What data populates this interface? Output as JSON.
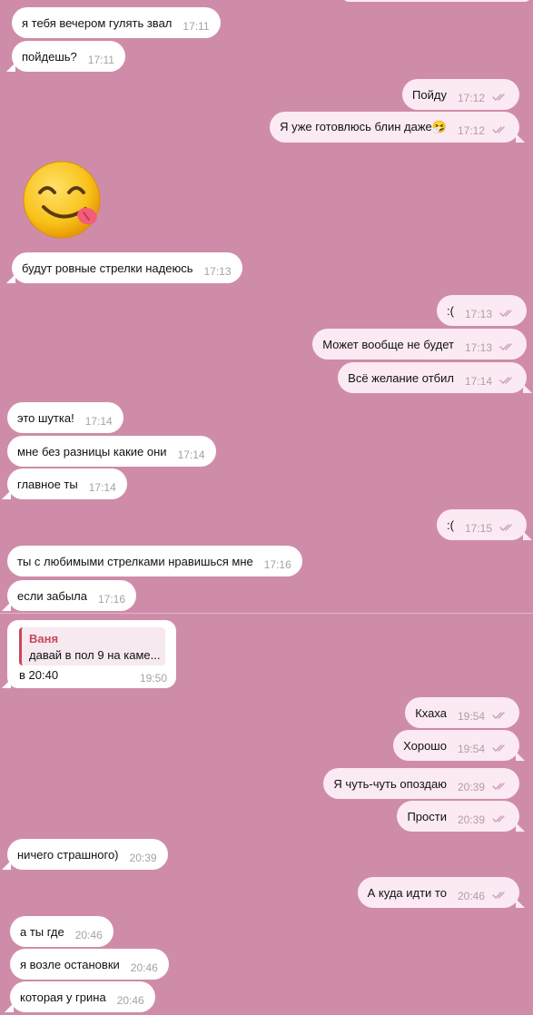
{
  "colors": {
    "background": "#cf8ca8",
    "incoming_bubble": "#ffffff",
    "outgoing_bubble": "#fbeaf3",
    "read_checks": "#c9a0b6",
    "reply_accent": "#c9465a"
  },
  "messages": [
    {
      "text": "я тебя вечером гулять звал",
      "time": "17:11"
    },
    {
      "text": "пойдешь?",
      "time": "17:11"
    },
    {
      "text": "Пойду",
      "time": "17:12"
    },
    {
      "text": "Я уже готовлюсь блин даже🤧",
      "time": "17:12"
    },
    {
      "sticker": "smiling-tongue-out-emoji"
    },
    {
      "text": "будут ровные стрелки надеюсь",
      "time": "17:13"
    },
    {
      "text": ":(",
      "time": "17:13"
    },
    {
      "text": "Может вообще не будет",
      "time": "17:13"
    },
    {
      "text": "Всё желание отбил",
      "time": "17:14"
    },
    {
      "text": "это шутка!",
      "time": "17:14"
    },
    {
      "text": "мне без разницы какие они",
      "time": "17:14"
    },
    {
      "text": "главное ты",
      "time": "17:14"
    },
    {
      "text": ":(",
      "time": "17:15"
    },
    {
      "text": "ты с любимыми стрелками нравишься мне",
      "time": "17:16"
    },
    {
      "text": "если забыла",
      "time": "17:16"
    },
    {
      "reply_to_name": "Ваня",
      "reply_to_text": "давай в пол 9 на каме...",
      "text": "в 20:40",
      "time": "19:50"
    },
    {
      "text": "Кхаха",
      "time": "19:54"
    },
    {
      "text": "Хорошо",
      "time": "19:54"
    },
    {
      "text": "Я чуть-чуть опоздаю",
      "time": "20:39"
    },
    {
      "text": "Прости",
      "time": "20:39"
    },
    {
      "text": "ничего страшного)",
      "time": "20:39"
    },
    {
      "text": "А куда идти то",
      "time": "20:46"
    },
    {
      "text": "а ты где",
      "time": "20:46"
    },
    {
      "text": "я возле остановки",
      "time": "20:46"
    },
    {
      "text": "которая у грина",
      "time": "20:46"
    }
  ]
}
